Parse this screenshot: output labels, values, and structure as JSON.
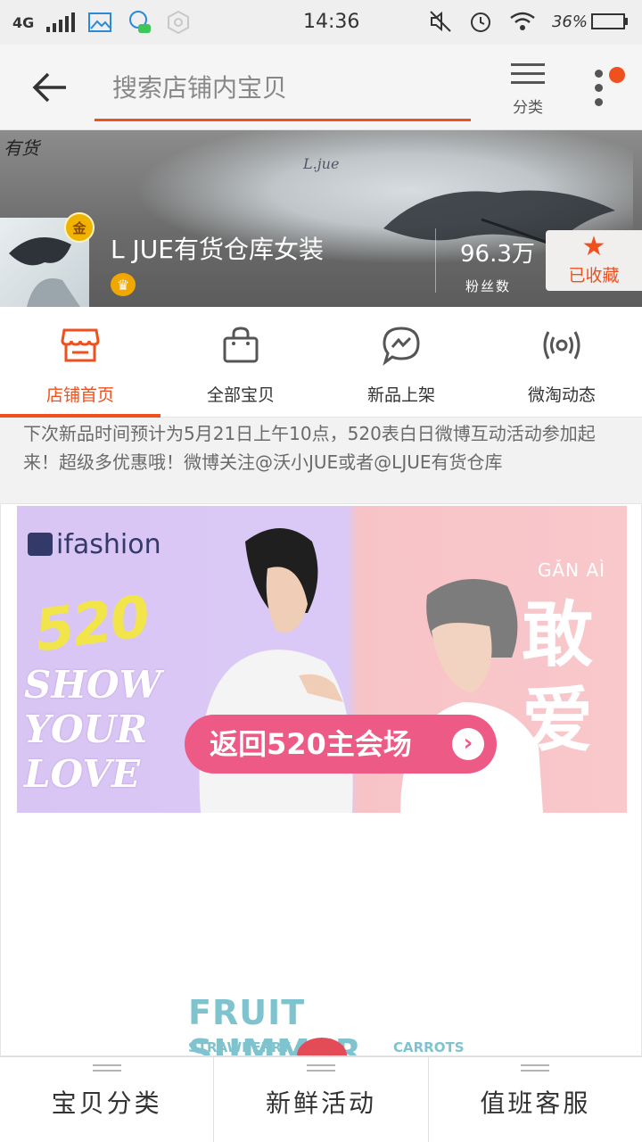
{
  "status_bar": {
    "network": "4G",
    "time": "14:36",
    "battery": "36%",
    "battery_level": 0.36
  },
  "header": {
    "search_placeholder": "搜索店铺内宝贝",
    "category_label": "分类"
  },
  "shop": {
    "name": "L JUE有货仓库女装",
    "badge": "金",
    "fans_count": "96.3万",
    "fans_label": "粉丝数",
    "favorite_label": "已收藏",
    "banner_logo_text": "有货",
    "banner_script_text": "L.jue"
  },
  "tabs": [
    {
      "label": "店铺首页",
      "icon": "store-icon",
      "active": true
    },
    {
      "label": "全部宝贝",
      "icon": "shopping-bag-icon",
      "active": false
    },
    {
      "label": "新品上架",
      "icon": "new-arrival-chat-icon",
      "active": false
    },
    {
      "label": "微淘动态",
      "icon": "broadcast-icon",
      "active": false
    }
  ],
  "notice": "下次新品时间预计为5月21日上午10点，520表白日微博互动活动参加起来！超级多优惠哦！微博关注@沃小JUE或者@LJUE有货仓库",
  "promo": {
    "brand": "ifashion",
    "big_number": "520",
    "slogan": "SHOW YOUR LOVE",
    "pinyin": "GǍN AÌ",
    "chinese_title": "敢爱",
    "button_label": "返回520主会场"
  },
  "fruit_banner": {
    "title": "FRUIT SUMMER",
    "left_label": "STRAWBERRY",
    "right_label": "CARROTS"
  },
  "bottom_bar": [
    {
      "label": "宝贝分类"
    },
    {
      "label": "新鲜活动"
    },
    {
      "label": "值班客服"
    }
  ],
  "colors": {
    "accent": "#f0501e",
    "status_bar_bg": "#efefef",
    "battery_fill": "#26b33c",
    "promo_button": "#ee5a86"
  }
}
